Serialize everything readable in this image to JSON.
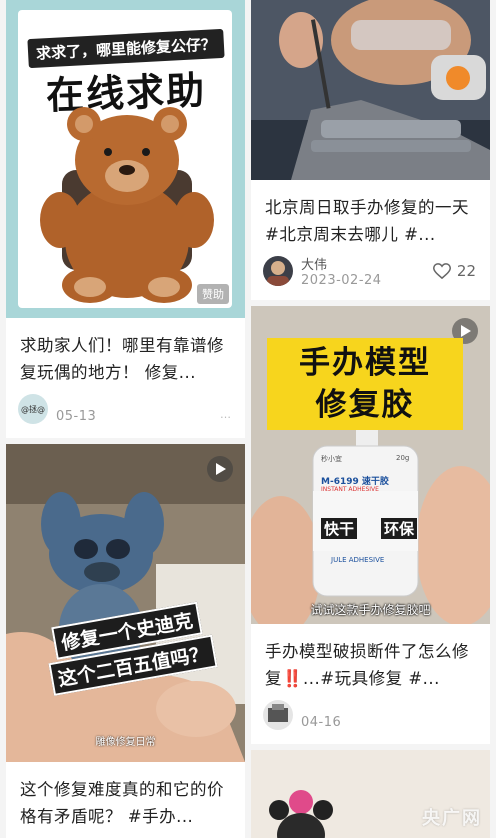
{
  "cards": {
    "c1": {
      "title": "求助家人们！哪里有靠谱修复玩偶的地方！ 修复...",
      "image_headline": "求求了，哪里能修复公仔？",
      "image_big_text": "在线求助",
      "image_tag": "赞助",
      "author_badge": "@拯@",
      "date": "05-13",
      "like_count": "…"
    },
    "c2": {
      "title": "北京周日取手办修复的一天 #北京周末去哪儿 #...",
      "author": "大伟",
      "date": "2023-02-24",
      "like_count": "22"
    },
    "c3": {
      "title": "这个修复难度真的和它的价格有矛盾呢？ #手办...",
      "image_caption_line1": "修复一个史迪克",
      "image_caption_line2": "这个二百五值吗？",
      "image_footer": "雕像修复日常"
    },
    "c4": {
      "title_part1": "手办模型破损断件了怎么修复",
      "title_emoji": "‼️",
      "title_part2": "...#玩具修复 #...",
      "image_title_line1": "手办模型",
      "image_title_line2": "修复胶",
      "bottle_brand": "秒小宜",
      "bottle_model": "M-6199 速干胶",
      "bottle_subtitle": "INSTANT ADHESIVE",
      "bottle_weight": "20g",
      "bottle_footer": "JULE ADHESIVE",
      "caption_fast": "快干",
      "caption_eco": "环保",
      "image_subtitle": "试试这款手办修复胶吧",
      "date": "04-16"
    },
    "c5": {}
  },
  "watermark": "央广网",
  "icons": {
    "play": "play-icon",
    "like": "heart-icon"
  },
  "colors": {
    "accent_yellow": "#f7d51d",
    "text_primary": "#222222",
    "text_secondary": "#999999"
  }
}
